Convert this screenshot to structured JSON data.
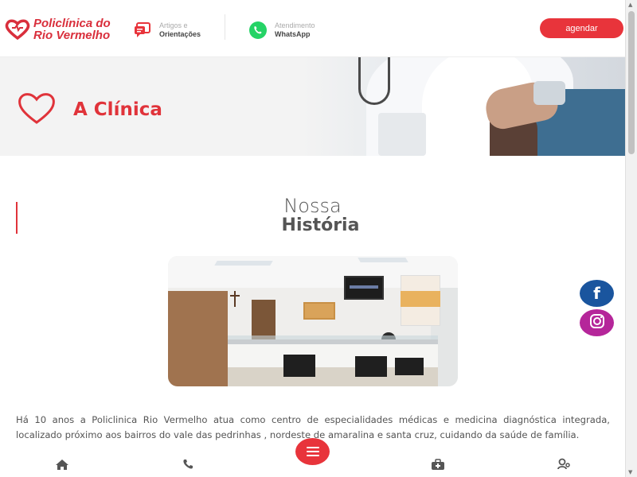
{
  "header": {
    "logo": {
      "line1": "Policlínica do",
      "line2": "Rio Vermelho"
    },
    "articles_link": {
      "small": "Artigos e",
      "big": "Orientações",
      "icon": "chat-card-icon"
    },
    "whatsapp_link": {
      "small": "Atendimento",
      "big": "WhatsApp",
      "icon": "whatsapp-icon"
    },
    "cta_label": "agendar"
  },
  "banner": {
    "title": "A Clínica",
    "icon": "heart-outline-icon"
  },
  "section": {
    "heading_light": "Nossa",
    "heading_bold": "História",
    "paragraph": "Há 10 anos a  Policlinica Rio Vermelho atua como centro de especialidades médicas e medicina diagnóstica integrada, localizado próximo aos bairros do vale das pedrinhas , nordeste de amaralina e santa cruz, cuidando da saúde de  família."
  },
  "social": {
    "facebook": "f",
    "instagram": "instagram-icon"
  },
  "bottom_nav": {
    "items": [
      "home-icon",
      "phone-icon",
      "menu-icon",
      "medkit-icon",
      "doctor-icon"
    ]
  },
  "colors": {
    "brand": "#e8343b",
    "facebook": "#1a559e",
    "instagram": "#b5269a"
  }
}
